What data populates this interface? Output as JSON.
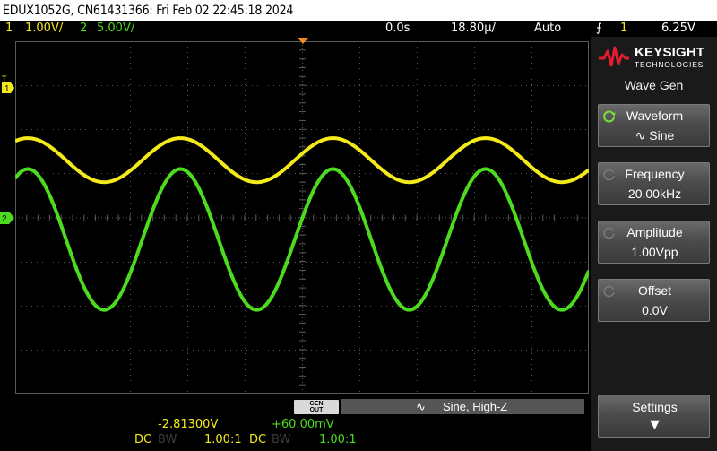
{
  "title_bar": {
    "text": "EDUX1052G, CN61431366: Fri Feb 02 22:45:18 2024"
  },
  "status": {
    "ch1_number": "1",
    "ch1_scale": "1.00V/",
    "ch2_number": "2",
    "ch2_scale": "5.00V/",
    "time_delay": "0.0s",
    "time_scale": "18.80µ/",
    "trigger_mode": "Auto",
    "trigger_source": "1",
    "trigger_level": "6.25V"
  },
  "markers": {
    "ch1_ground": "1",
    "ch2_ground": "2",
    "trigger_level_marker": "T"
  },
  "panel": {
    "brand": "KEYSIGHT",
    "brand_sub": "TECHNOLOGIES",
    "menu_title": "Wave Gen",
    "softkeys": [
      {
        "label": "Waveform",
        "value": "∿ Sine"
      },
      {
        "label": "Frequency",
        "value": "20.00kHz"
      },
      {
        "label": "Amplitude",
        "value": "1.00Vpp"
      },
      {
        "label": "Offset",
        "value": "0.0V"
      },
      {
        "label": "Settings",
        "value": "▼"
      }
    ]
  },
  "bottom": {
    "gen_out_line1": "GEN",
    "gen_out_line2": "OUT",
    "gen_status": "Sine, High-Z",
    "ch1_offset": "-2.81300V",
    "ch2_offset": "+60.00mV",
    "ch1_coupling": "DC",
    "ch1_bw": "BW",
    "ch1_probe": "1.00:1",
    "ch2_coupling": "DC",
    "ch2_bw": "BW",
    "ch2_probe": "1.00:1"
  },
  "colors": {
    "ch1": "#f4ea1a",
    "ch2": "#4cdb1e",
    "trigger_marker": "#f08c1c",
    "grid": "#5a5a5a",
    "background": "#000000"
  },
  "traces": {
    "ch1": {
      "cycles_on_screen": 3.76,
      "amplitude_divs": 0.5,
      "center_div": -1.3
    },
    "ch2": {
      "cycles_on_screen": 3.76,
      "amplitude_divs": 1.6,
      "center_div": 0.5
    }
  }
}
